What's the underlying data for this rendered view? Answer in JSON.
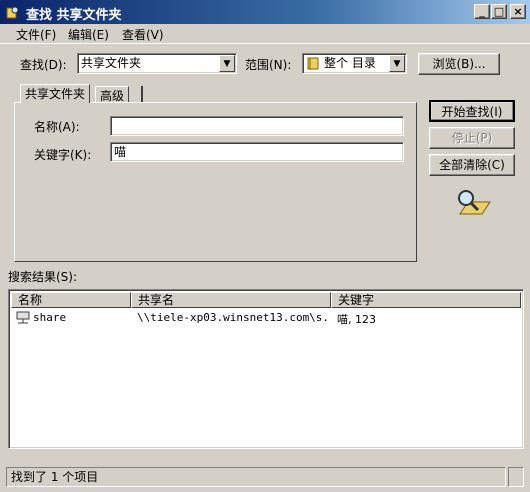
{
  "window": {
    "title": "查找 共享文件夹",
    "minimize": "_",
    "maximize": "□",
    "close": "×"
  },
  "menu": [
    "文件(F)",
    "编辑(E)",
    "查看(V)"
  ],
  "find": {
    "label": "查找(D):",
    "value": "共享文件夹",
    "range_label": "范围(N):",
    "range_value": "整个 目录",
    "browse_button": "浏览(B)..."
  },
  "tabs": [
    "共享文件夹",
    "高级"
  ],
  "form": {
    "name_label": "名称(A):",
    "name_value": "",
    "keyword_label": "关键字(K):",
    "keyword_value": "喵"
  },
  "buttons": {
    "start": "开始查找(I)",
    "stop": "停止(P)",
    "clear": "全部清除(C)"
  },
  "results": {
    "label": "搜索结果(S):",
    "columns": [
      "名称",
      "共享名",
      "关键字"
    ],
    "rows": [
      {
        "name": "share",
        "share_name": "\\\\tiele-xp03.winsnet13.com\\s...",
        "keywords": "喵, 123"
      }
    ]
  },
  "status": {
    "text": "找到了 1 个项目"
  }
}
